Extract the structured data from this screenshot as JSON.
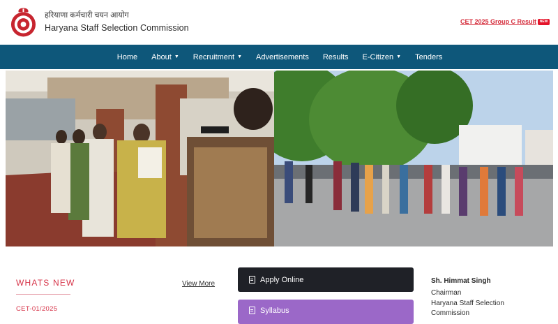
{
  "header": {
    "org_name_hindi": "हरियाणा कर्मचारी चयन आयोग",
    "org_name_english": "Haryana Staff Selection Commission",
    "result_link": "CET 2025 Group C Result",
    "new_badge": "NEW"
  },
  "nav": {
    "items": [
      {
        "label": "Home",
        "dropdown": false
      },
      {
        "label": "About",
        "dropdown": true
      },
      {
        "label": "Recruitment",
        "dropdown": true
      },
      {
        "label": "Advertisements",
        "dropdown": false
      },
      {
        "label": "Results",
        "dropdown": false
      },
      {
        "label": "E-Citizen",
        "dropdown": true
      },
      {
        "label": "Tenders",
        "dropdown": false
      }
    ]
  },
  "whats_new": {
    "title": "WHATS NEW",
    "view_more": "View More",
    "items": [
      "CET-01/2025"
    ]
  },
  "actions": {
    "apply_online": "Apply Online",
    "syllabus": "Syllabus"
  },
  "chairman": {
    "name": "Sh. Himmat Singh",
    "role": "Chairman",
    "org": "Haryana Staff Selection",
    "org_cont": "Commission"
  },
  "colors": {
    "nav_bg": "#0e577a",
    "accent_red": "#d63247",
    "apply_bg": "#1f2127",
    "syllabus_bg": "#9b68c8"
  }
}
